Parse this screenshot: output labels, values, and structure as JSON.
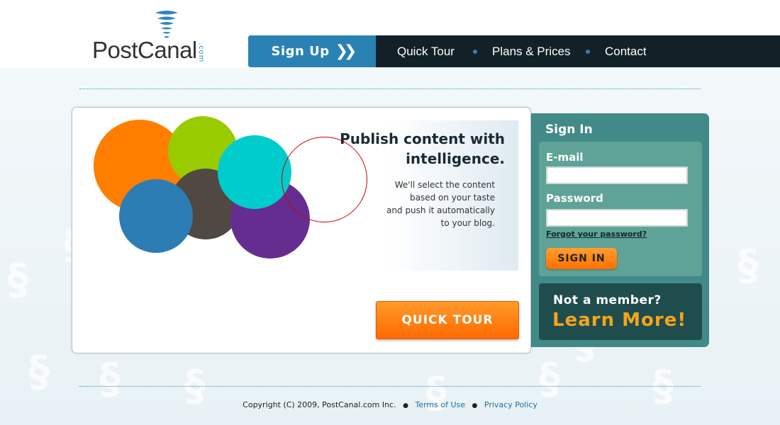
{
  "logo": {
    "name": "PostCanal",
    "suffix": ".com"
  },
  "nav": {
    "signup_label": "Sign Up",
    "items": [
      "Quick Tour",
      "Plans & Prices",
      "Contact"
    ]
  },
  "promo": {
    "headline_line1": "Publish content with",
    "headline_line2": "intelligence.",
    "sub_line1": "We'll select the content",
    "sub_line2": "based on your taste",
    "sub_line3": "and push it automatically",
    "sub_line4": "to your blog.",
    "quick_tour_label": "QUICK TOUR",
    "circle_colors": [
      "#ff7e00",
      "#99cc00",
      "#4f4843",
      "#2b7db3",
      "#00cccc",
      "#662d91",
      "#cc0000"
    ]
  },
  "signin": {
    "title": "Sign In",
    "email_label": "E-mail",
    "email_value": "",
    "password_label": "Password",
    "password_value": "",
    "forgot_label": "Forgot your password?",
    "button_label": "SIGN IN",
    "member_question": "Not a member?",
    "member_cta": "Learn More!"
  },
  "footer": {
    "copyright": "Copyright (C) 2009, PostCanal.com Inc.",
    "terms": "Terms of Use",
    "privacy": "Privacy Policy"
  },
  "colors": {
    "nav_bg": "#122127",
    "signup_blue": "#2a82b4",
    "signin_teal": "#428a87",
    "accent_orange": "#ff7e00",
    "cta_gold": "#f5a51a"
  }
}
